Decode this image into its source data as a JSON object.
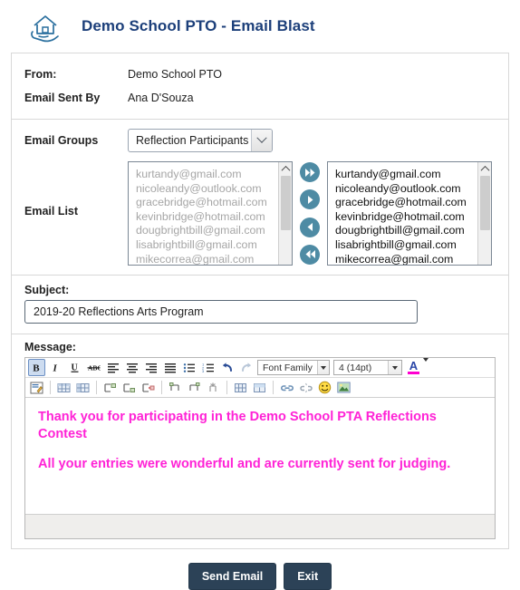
{
  "header": {
    "logo_icon": "house-in-hand-icon",
    "title": "Demo School PTO - Email Blast"
  },
  "info": {
    "from_label": "From:",
    "from_value": "Demo School PTO",
    "sent_by_label": "Email Sent By",
    "sent_by_value": "Ana D'Souza"
  },
  "groups": {
    "label": "Email Groups",
    "selected": "Reflection Participants"
  },
  "email_list": {
    "label": "Email List",
    "available": [
      "kurtandy@gmail.com",
      "nicoleandy@outlook.com",
      "gracebridge@hotmail.com",
      "kevinbridge@hotmail.com",
      "dougbrightbill@gmail.com",
      "lisabrightbill@gmail.com",
      "mikecorrea@gmail.com"
    ],
    "selected": [
      "kurtandy@gmail.com",
      "nicoleandy@outlook.com",
      "gracebridge@hotmail.com",
      "kevinbridge@hotmail.com",
      "dougbrightbill@gmail.com",
      "lisabrightbill@gmail.com",
      "mikecorrea@gmail.com"
    ],
    "transfer_buttons": [
      {
        "name": "move-all-right-button",
        "icon": "double-chevron-right-icon"
      },
      {
        "name": "move-right-button",
        "icon": "chevron-right-icon"
      },
      {
        "name": "move-left-button",
        "icon": "chevron-left-icon"
      },
      {
        "name": "move-all-left-button",
        "icon": "double-chevron-left-icon"
      }
    ]
  },
  "subject": {
    "label": "Subject:",
    "value": "2019-20  Reflections Arts Program"
  },
  "message": {
    "label": "Message:",
    "toolbar_row1": [
      {
        "name": "bold-button",
        "icon": "bold-icon",
        "label": "B",
        "active": true
      },
      {
        "name": "italic-button",
        "icon": "italic-icon",
        "label": "I",
        "active": false
      },
      {
        "name": "underline-button",
        "icon": "underline-icon",
        "label": "U",
        "active": false
      },
      {
        "name": "strikethrough-button",
        "icon": "strikethrough-icon",
        "label": "ABC",
        "active": false
      },
      {
        "name": "align-left-button",
        "icon": "align-left-icon",
        "label": "",
        "active": false
      },
      {
        "name": "align-center-button",
        "icon": "align-center-icon",
        "label": "",
        "active": false
      },
      {
        "name": "align-right-button",
        "icon": "align-right-icon",
        "label": "",
        "active": false
      },
      {
        "name": "align-justify-button",
        "icon": "align-justify-icon",
        "label": "",
        "active": false
      },
      {
        "name": "bullet-list-button",
        "icon": "bullet-list-icon",
        "label": "",
        "active": false
      },
      {
        "name": "numbered-list-button",
        "icon": "numbered-list-icon",
        "label": "",
        "active": false
      },
      {
        "name": "undo-button",
        "icon": "undo-icon",
        "label": "",
        "active": false
      },
      {
        "name": "redo-button",
        "icon": "redo-icon",
        "label": "",
        "active": false
      }
    ],
    "font_family_label": "Font Family",
    "font_size_label": "4 (14pt)",
    "text_color_label": "A",
    "text_color_value": "#ff00d0",
    "toolbar_row2": [
      {
        "name": "edit-source-button",
        "icon": "pencil-edit-icon"
      },
      {
        "name": "insert-table-button",
        "icon": "table-icon"
      },
      {
        "name": "table-properties-button",
        "icon": "table-properties-icon"
      },
      {
        "name": "insert-row-before-button",
        "icon": "row-insert-above-icon"
      },
      {
        "name": "insert-row-after-button",
        "icon": "row-insert-below-icon"
      },
      {
        "name": "delete-row-button",
        "icon": "row-delete-icon"
      },
      {
        "name": "insert-column-before-button",
        "icon": "column-insert-left-icon"
      },
      {
        "name": "insert-column-after-button",
        "icon": "column-insert-right-icon"
      },
      {
        "name": "delete-column-button",
        "icon": "column-delete-icon"
      },
      {
        "name": "split-cell-button",
        "icon": "cell-split-icon"
      },
      {
        "name": "merge-cell-button",
        "icon": "cell-merge-icon"
      },
      {
        "name": "insert-link-button",
        "icon": "link-icon"
      },
      {
        "name": "remove-link-button",
        "icon": "unlink-icon"
      },
      {
        "name": "insert-emoticon-button",
        "icon": "smiley-icon"
      },
      {
        "name": "insert-image-button",
        "icon": "image-icon"
      }
    ],
    "body_paragraphs": [
      "Thank you for participating in the Demo School PTA Reflections Contest",
      "All your entries were wonderful and are currently sent for judging."
    ]
  },
  "footer": {
    "send_label": "Send Email",
    "exit_label": "Exit"
  },
  "colors": {
    "title": "#1c3f7a",
    "transfer_button": "#4e8ba4",
    "message_text": "#ff22d6",
    "footer_button": "#2c4257"
  }
}
